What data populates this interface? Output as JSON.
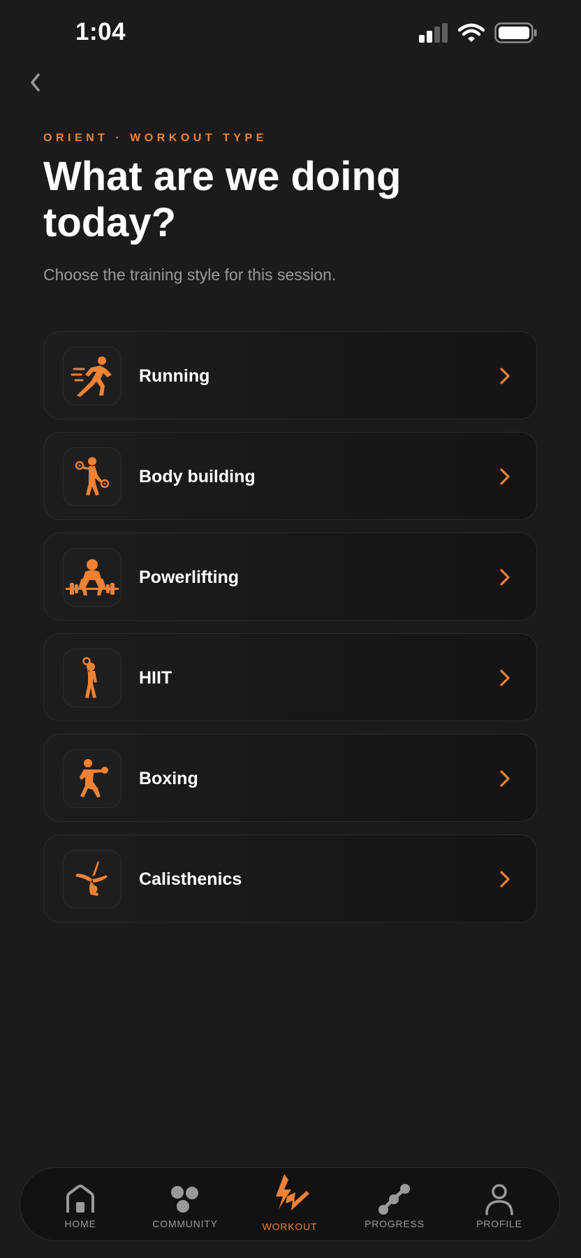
{
  "status_bar": {
    "time": "1:04"
  },
  "header": {
    "back_icon": "chevron-left-icon",
    "eyebrow": "ORIENT · WORKOUT TYPE",
    "title": "What are we doing today?",
    "subtitle": "Choose the training style for this session."
  },
  "workouts": [
    {
      "label": "Running",
      "icon": "running-icon"
    },
    {
      "label": "Body building",
      "icon": "body-building-icon"
    },
    {
      "label": "Powerlifting",
      "icon": "powerlifting-icon"
    },
    {
      "label": "HIIT",
      "icon": "hiit-icon"
    },
    {
      "label": "Boxing",
      "icon": "boxing-icon"
    },
    {
      "label": "Calisthenics",
      "icon": "calisthenics-icon"
    }
  ],
  "nav": {
    "items": [
      {
        "label": "HOME",
        "icon": "home-icon"
      },
      {
        "label": "COMMUNITY",
        "icon": "community-icon"
      },
      {
        "label": "WORKOUT",
        "icon": "workout-icon",
        "active": true
      },
      {
        "label": "PROGRESS",
        "icon": "progress-icon"
      },
      {
        "label": "PROFILE",
        "icon": "profile-icon"
      }
    ]
  },
  "colors": {
    "background": "#1b1b1c",
    "accent": "#ef8234",
    "text_primary": "#ffffff",
    "text_secondary": "#9a9a9a",
    "card_border": "#2a2a2c"
  }
}
